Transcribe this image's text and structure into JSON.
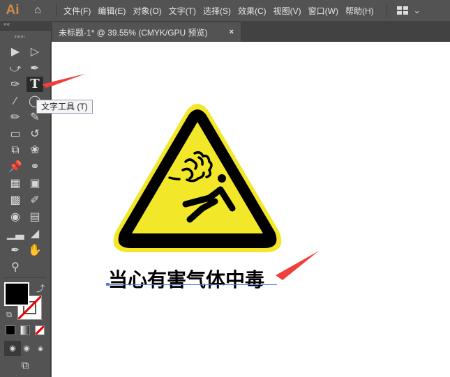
{
  "app": {
    "logo": "Ai",
    "home_icon": "home-icon"
  },
  "menu": [
    "文件(F)",
    "编辑(E)",
    "对象(O)",
    "文字(T)",
    "选择(S)",
    "效果(C)",
    "视图(V)",
    "窗口(W)",
    "帮助(H)"
  ],
  "tab": {
    "title": "未标题-1* @ 39.55% (CMYK/GPU 预览)",
    "close": "×"
  },
  "panel": {
    "collapse": "««"
  },
  "tooltip": "文字工具 (T)",
  "canvas": {
    "sign_text": "当心有害气体中毒"
  },
  "colors": {
    "sign_yellow": "#f2e829",
    "arrow_red": "#f0403a",
    "ui_dark": "#535353"
  }
}
